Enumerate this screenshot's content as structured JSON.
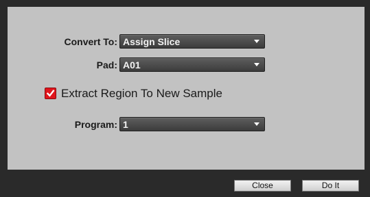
{
  "form": {
    "convert_to": {
      "label": "Convert To:",
      "value": "Assign Slice"
    },
    "pad": {
      "label": "Pad:",
      "value": "A01"
    },
    "extract_region": {
      "label": "Extract Region To New Sample",
      "checked": true
    },
    "program": {
      "label": "Program:",
      "value": "1"
    }
  },
  "buttons": {
    "close_label": "Close",
    "do_it_label": "Do It"
  },
  "colors": {
    "checkbox_fill": "#e0151c",
    "panel_background": "#c2c2c2",
    "dialog_background": "#2a2a2a"
  },
  "icons": {
    "dropdown": "chevron-down-icon",
    "checkbox": "checkmark-icon"
  }
}
